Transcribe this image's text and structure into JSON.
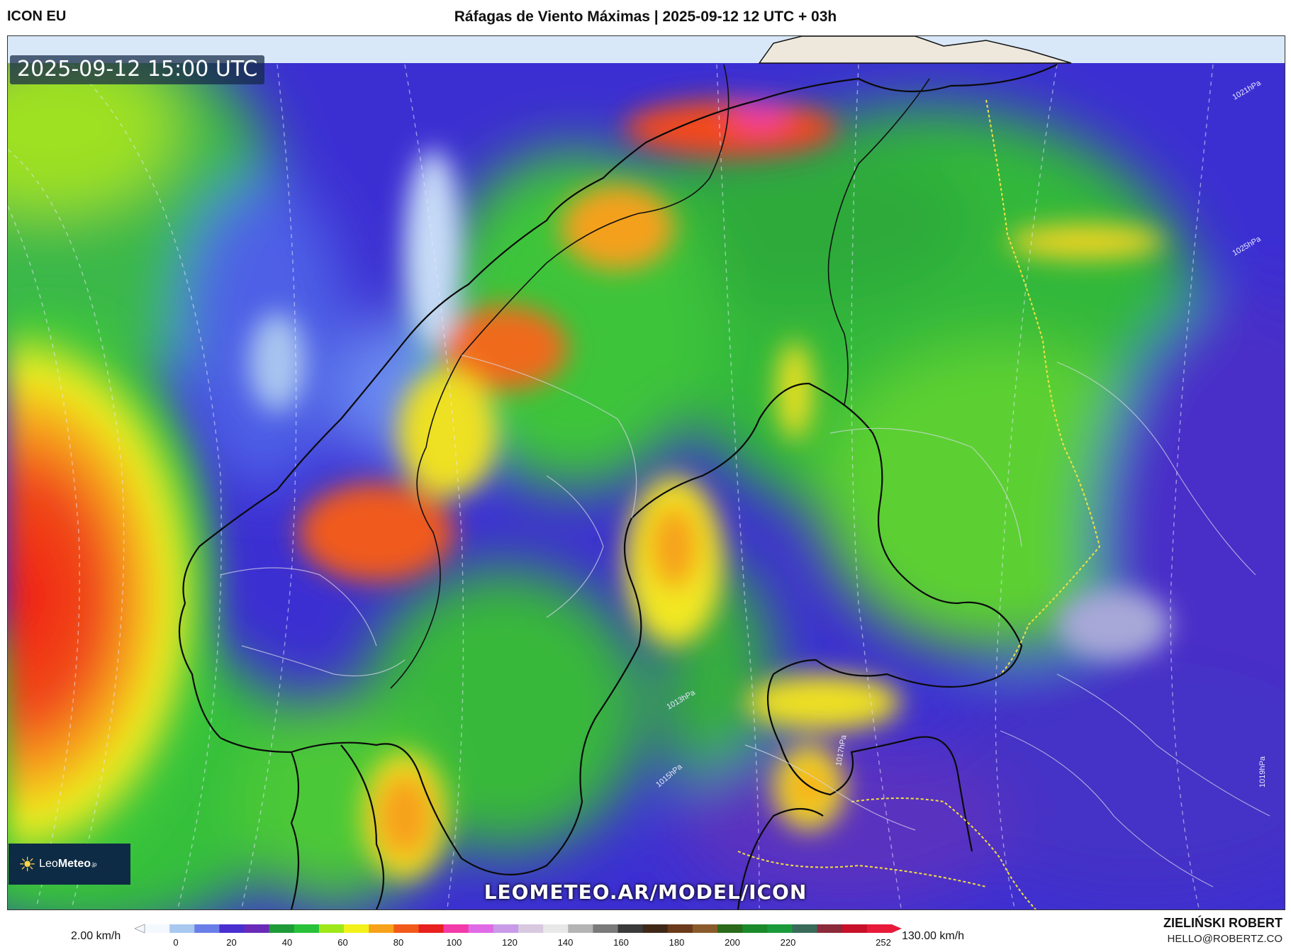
{
  "header": {
    "model": "ICON EU",
    "title": "Ráfagas de Viento Máximas | 2025-09-12 12 UTC + 03h"
  },
  "map": {
    "valid_time": "2025-09-12 15:00 UTC",
    "watermark": "LEOMETEO.AR/MODEL/ICON",
    "logo_text_light": "Leo",
    "logo_text_bold": "Meteo",
    "logo_text_small": ".jp",
    "isobar_labels": [
      "1021hPa",
      "1025hPa",
      "1013hPa",
      "1019hPa",
      "1015hPa",
      "1017hPa"
    ]
  },
  "colorbar": {
    "min_label": "2.00 km/h",
    "max_label": "130.00 km/h",
    "ticks": [
      "0",
      "20",
      "40",
      "60",
      "80",
      "100",
      "120",
      "140",
      "160",
      "180",
      "200",
      "220",
      "252"
    ],
    "colors": [
      "#f4f8ff",
      "#a8c8f0",
      "#6a7ee8",
      "#4a2fd0",
      "#6a2ab8",
      "#1f9a38",
      "#28c23a",
      "#9ee81a",
      "#f2f21a",
      "#f6a21a",
      "#f25a1a",
      "#e8201e",
      "#f23aa8",
      "#e06ae6",
      "#c89ae8",
      "#d8c8e0",
      "#e8e8e8",
      "#b4b4b4",
      "#7a7a7a",
      "#3a3a3a",
      "#402818",
      "#6a3a1a",
      "#8a5a2a",
      "#2a6a1a",
      "#1a8a2a",
      "#1a9a3a",
      "#3a6a5a",
      "#8a2a3a",
      "#c8102a",
      "#e81a3a"
    ]
  },
  "credit": {
    "name": "ZIELIŃSKI ROBERT",
    "email": "HELLO@ROBERTZ.CO"
  }
}
